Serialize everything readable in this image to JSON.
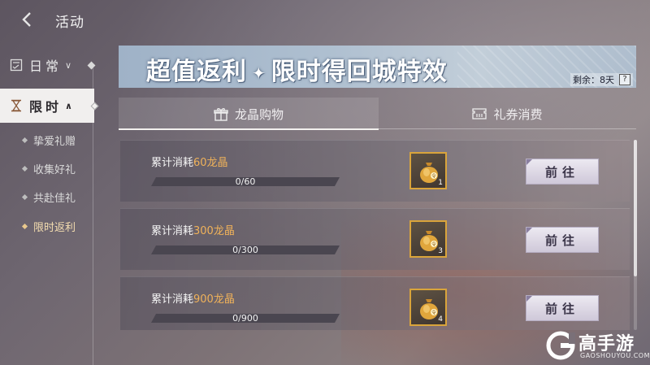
{
  "header": {
    "title": "活动"
  },
  "sidebar": {
    "categories": [
      {
        "label": "日常",
        "state": "collapsed"
      },
      {
        "label": "限时",
        "state": "expanded"
      }
    ],
    "sub_items": [
      "挚爱礼赠",
      "收集好礼",
      "共赴佳礼",
      "限时返利"
    ],
    "active_sub_item": "限时返利"
  },
  "banner": {
    "title_part1": "超值返利",
    "title_part2": "限时得回城特效",
    "remaining": "剩余：8天",
    "help": "?"
  },
  "tabs": [
    {
      "label": "龙晶购物",
      "icon": "gift-icon",
      "selected": true
    },
    {
      "label": "礼券消费",
      "icon": "coupon-icon",
      "selected": false
    }
  ],
  "rewards": [
    {
      "prefix": "累计消耗",
      "amount": "60龙晶",
      "progress_text": "0/60",
      "progress": 0,
      "reward_count": "1",
      "button": "前往"
    },
    {
      "prefix": "累计消耗",
      "amount": "300龙晶",
      "progress_text": "0/300",
      "progress": 0,
      "reward_count": "3",
      "button": "前往"
    },
    {
      "prefix": "累计消耗",
      "amount": "900龙晶",
      "progress_text": "0/900",
      "progress": 0,
      "reward_count": "4",
      "button": "前往"
    }
  ],
  "watermark": {
    "name": "高手游",
    "domain": "GAOSHOUYOU.COM"
  },
  "colors": {
    "highlight": "#f0b25a",
    "active_sub": "#f4ddb0",
    "reward_border": "#d9a43b"
  }
}
